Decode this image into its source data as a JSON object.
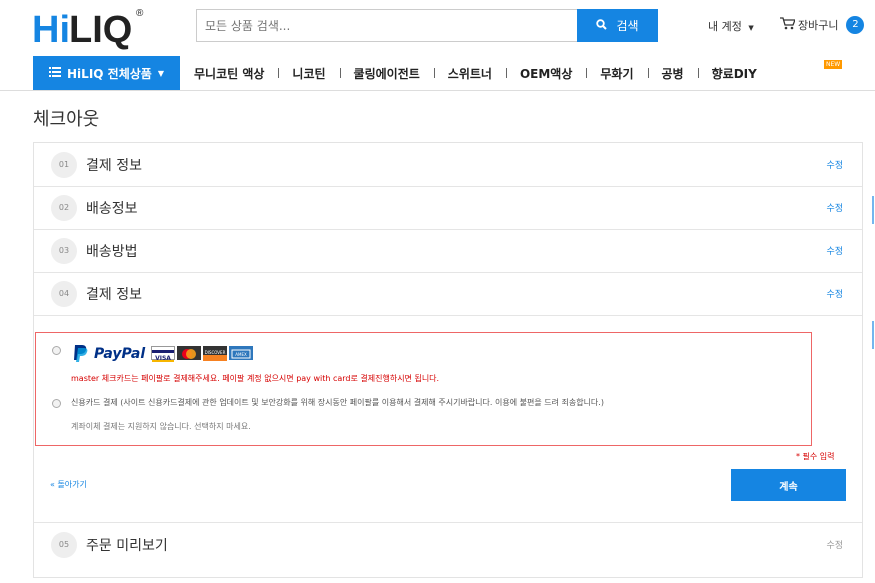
{
  "brand": {
    "logo_text": "HiLIQ",
    "registered": "®"
  },
  "search": {
    "placeholder": "모든 상품 검색...",
    "button_label": "검색"
  },
  "header": {
    "account_label": "내 계정",
    "cart_label": "장바구니",
    "cart_count": "2"
  },
  "nav": {
    "all_products": "HiLIQ 전체상품",
    "items": [
      {
        "label": "무니코틴 액상"
      },
      {
        "label": "니코틴"
      },
      {
        "label": "쿨링에이전트"
      },
      {
        "label": "스위트너"
      },
      {
        "label": "OEM액상"
      },
      {
        "label": "무화기"
      },
      {
        "label": "공병"
      },
      {
        "label": "향료DIY"
      }
    ],
    "new_badge": "NEW"
  },
  "page": {
    "title": "체크아웃"
  },
  "steps": [
    {
      "num": "01",
      "title": "결제 정보",
      "edit": "수정"
    },
    {
      "num": "02",
      "title": "배송정보",
      "edit": "수정"
    },
    {
      "num": "03",
      "title": "배송방법",
      "edit": "수정"
    },
    {
      "num": "04",
      "title": "결제 정보",
      "edit": "수정"
    },
    {
      "num": "05",
      "title": "주문 미리보기",
      "edit": "수정"
    }
  ],
  "payment": {
    "paypal_label": "PayPal",
    "cards": [
      {
        "name": "VISA",
        "color": "#1a1f71"
      },
      {
        "name": "MasterCard",
        "color": "#eb001b"
      },
      {
        "name": "DISCOVER",
        "color": "#333333"
      },
      {
        "name": "AMERICAN EXPRESS",
        "color": "#2e77bc"
      }
    ],
    "paypal_note": "master 체크카드는 페이팔로 결제해주세요. 페이팔 계정 없으시면 pay with card로 결제진행하시면 됩니다.",
    "credit_card_label": "신용카드 결제 (사이트 신용카드결제에 관한 업데이트 및 보안강화를 위해 장시동안 페이팔를 이용해서 결제해 주시기바랍니다. 이용에 불편을 드려 죄송합니다.)",
    "bank_transfer_note": "계좌이체 결제는 지원하지 않습니다. 선택하지 마세요."
  },
  "form": {
    "required_note": "* 필수 입력",
    "back_link": "« 돌아가기",
    "continue_button": "계속"
  },
  "colors": {
    "accent": "#1585e2",
    "warning": "#d60000",
    "border": "#e5e5e5"
  }
}
